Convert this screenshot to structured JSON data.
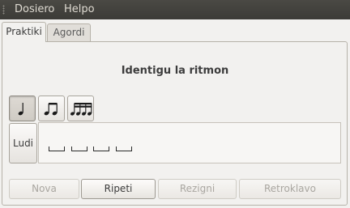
{
  "menubar": {
    "items": [
      {
        "label": "Dosiero"
      },
      {
        "label": "Helpo"
      }
    ]
  },
  "tabs": [
    {
      "label": "Praktiki",
      "active": true
    },
    {
      "label": "Agordi",
      "active": false
    }
  ],
  "exercise": {
    "title": "Identigu la ritmon",
    "rhythm_buttons": [
      {
        "icon": "quarter-note-icon",
        "active": true
      },
      {
        "icon": "eighth-notes-icon",
        "active": false
      },
      {
        "icon": "sixteenth-notes-icon",
        "active": false
      }
    ],
    "play_label": "Ludi",
    "answer_slots": 4
  },
  "actions": {
    "new_label": "Nova",
    "repeat_label": "Ripeti",
    "give_up_label": "Rezigni",
    "back_label": "Retroklavo"
  },
  "colors": {
    "menubar_bg": "#3c3b37",
    "menubar_text": "#dfdbd2",
    "window_bg": "#f2f1ef",
    "disabled_text": "#a9a6a0"
  }
}
